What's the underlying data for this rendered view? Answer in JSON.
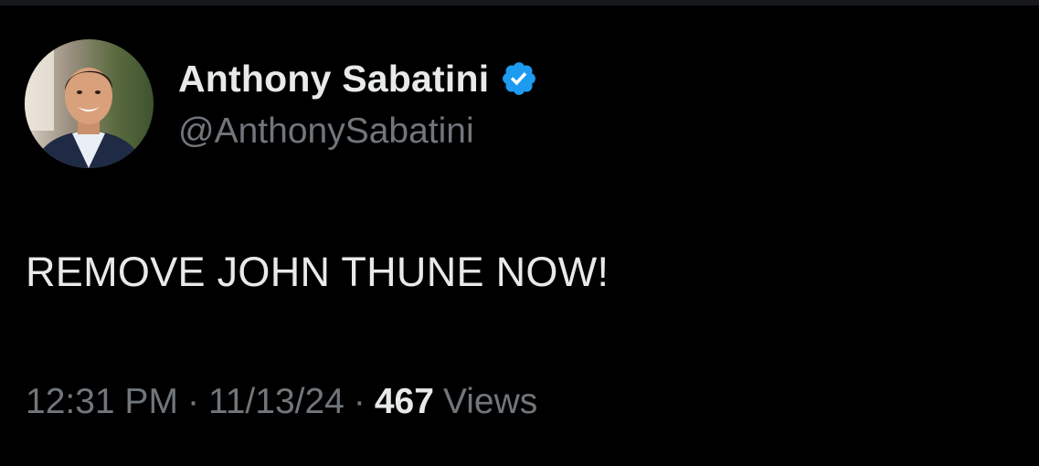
{
  "author": {
    "display_name": "Anthony Sabatini",
    "handle": "@AnthonySabatini",
    "verified": true,
    "avatar": "avatar-photo"
  },
  "tweet": {
    "text": "REMOVE JOHN THUNE NOW!"
  },
  "meta": {
    "time": "12:31 PM",
    "separator": "·",
    "date": "11/13/24",
    "views_count": "467",
    "views_label": "Views"
  },
  "colors": {
    "background": "#000000",
    "primary_text": "#e7e9ea",
    "secondary_text": "#71767b",
    "verified_badge": "#1d9bf0"
  },
  "icons": {
    "verified": "verified-badge-icon"
  }
}
